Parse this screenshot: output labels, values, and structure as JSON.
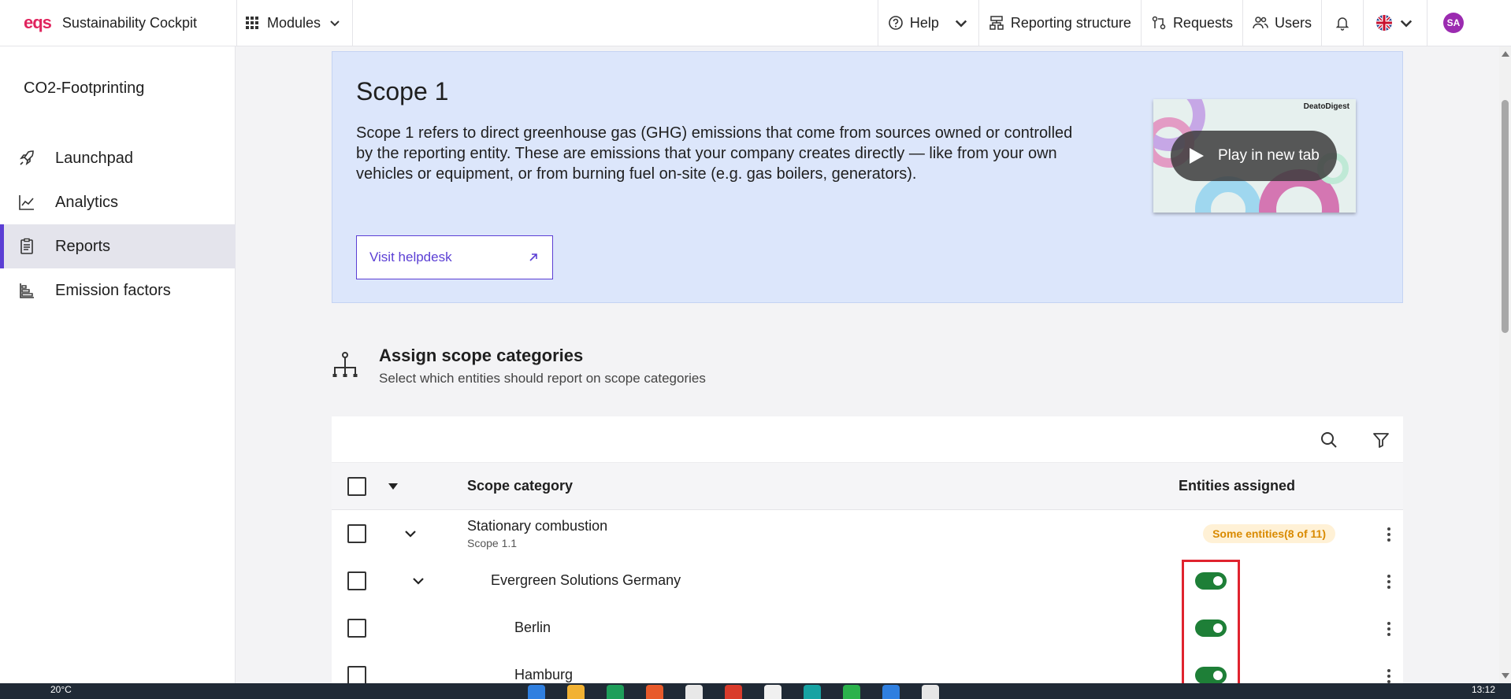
{
  "topbar": {
    "brand_logo": "eqs",
    "brand_name": "Sustainability Cockpit",
    "modules_label": "Modules",
    "help_label": "Help",
    "reporting_label": "Reporting structure",
    "requests_label": "Requests",
    "users_label": "Users",
    "avatar_initials": "SA"
  },
  "sidebar": {
    "title": "CO2-Footprinting",
    "items": [
      {
        "label": "Launchpad",
        "icon": "rocket-icon"
      },
      {
        "label": "Analytics",
        "icon": "line-chart-icon"
      },
      {
        "label": "Reports",
        "icon": "clipboard-icon",
        "active": true
      },
      {
        "label": "Emission factors",
        "icon": "bar-chart-icon"
      }
    ]
  },
  "hero": {
    "title": "Scope 1",
    "description": "Scope 1 refers to direct greenhouse gas (GHG) emissions that come from sources owned or controlled by the reporting entity. These are emissions that your company creates directly — like from your own vehicles or equipment, or from burning fuel on-site (e.g. gas boilers, generators).",
    "helpdesk_label": "Visit helpdesk",
    "video_brand": "DeatoDigest",
    "video_play_label": "Play in new tab"
  },
  "assign": {
    "title": "Assign scope categories",
    "subtitle": "Select which entities should report on scope categories"
  },
  "table": {
    "col_category": "Scope category",
    "col_entities": "Entities assigned",
    "rows": [
      {
        "name": "Stationary combustion",
        "sub": "Scope 1.1",
        "badge": "Some entities(8 of 11)"
      },
      {
        "name": "Evergreen Solutions Germany",
        "toggle": true
      },
      {
        "name": "Berlin",
        "toggle": true
      },
      {
        "name": "Hamburg",
        "toggle": true
      }
    ]
  },
  "taskbar": {
    "weather": "20°C",
    "time": "13:12"
  },
  "colors": {
    "accent": "#5b3fd4",
    "brand": "#e0245e",
    "toggle_on": "#1e7f37",
    "badge_text": "#d98a00",
    "hero_bg": "#dce6fb"
  }
}
